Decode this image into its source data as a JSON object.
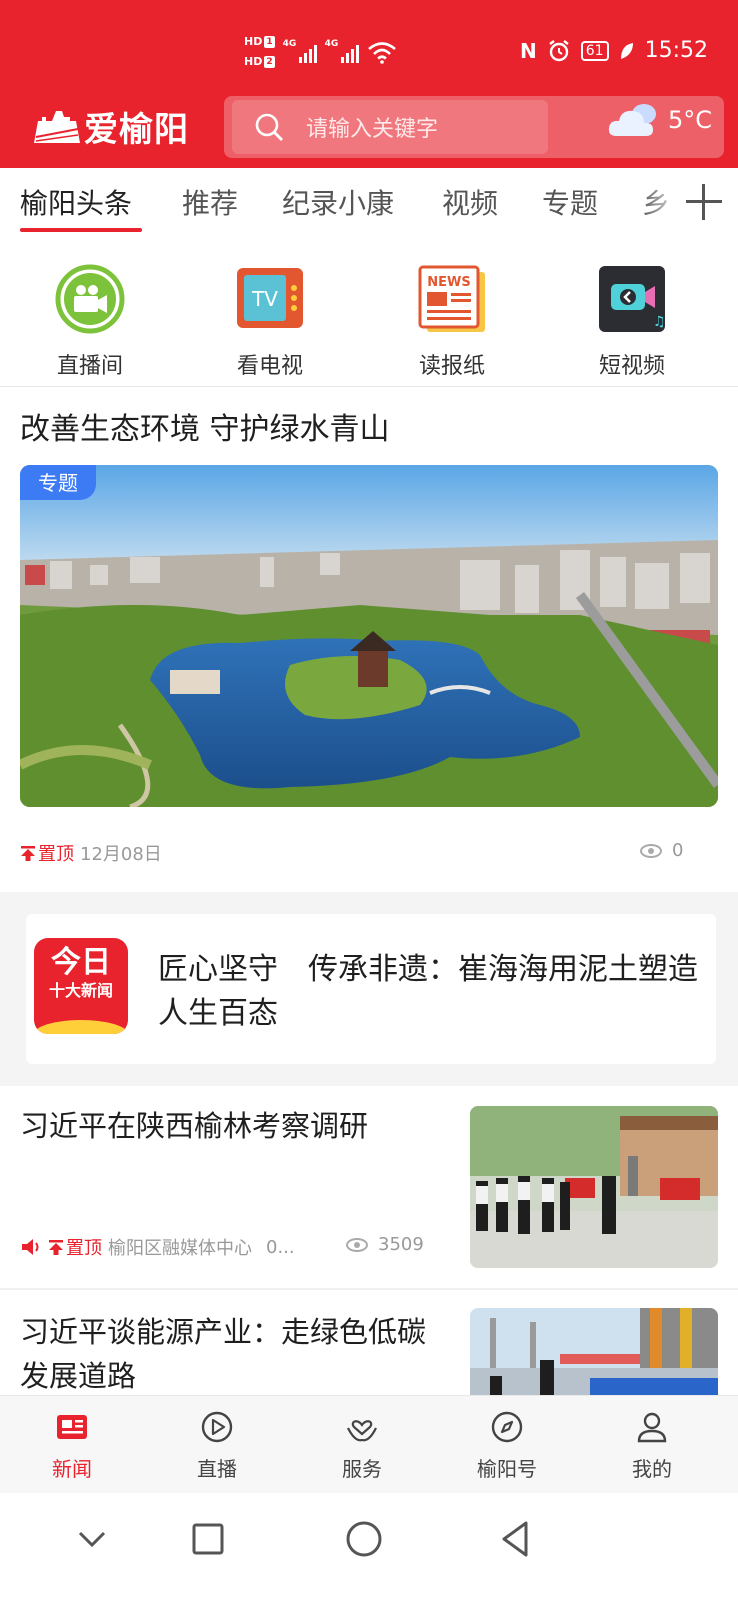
{
  "status_bar": {
    "hd1": "HD",
    "hd1_num": "1",
    "hd2": "HD",
    "hd2_num": "2",
    "net1": "4G",
    "net2": "4G",
    "nfc": "N",
    "battery": "61",
    "time": "15:52"
  },
  "header": {
    "app_name": "爱榆阳",
    "search_placeholder": "请输入关键字",
    "temperature": "5°C",
    "weather_icon": "cloudy-icon"
  },
  "tabs": [
    "榆阳头条",
    "推荐",
    "纪录小康",
    "视频",
    "专题",
    "乡"
  ],
  "active_tab": 0,
  "quick_links": [
    {
      "label": "直播间",
      "icon": "video-camera-icon"
    },
    {
      "label": "看电视",
      "icon": "tv-icon"
    },
    {
      "label": "读报纸",
      "icon": "newspaper-icon"
    },
    {
      "label": "短视频",
      "icon": "short-video-icon"
    }
  ],
  "feature": {
    "title": "改善生态环境 守护绿水青山",
    "tag": "专题",
    "pin": "置顶",
    "date": "12月08日",
    "views": "0"
  },
  "today_card": {
    "badge_line1": "今日",
    "badge_line2": "十大新闻",
    "title": "匠心坚守　传承非遗：崔海海用泥土塑造人生百态"
  },
  "news": [
    {
      "title": "习近平在陕西榆林考察调研",
      "pin": "置顶",
      "source": "榆阳区融媒体中心",
      "extra": "0...",
      "views": "3509"
    },
    {
      "title": "习近平谈能源产业：走绿色低碳发展道路"
    }
  ],
  "bottom_nav": [
    {
      "label": "新闻",
      "icon": "news-icon"
    },
    {
      "label": "直播",
      "icon": "play-icon"
    },
    {
      "label": "服务",
      "icon": "service-icon"
    },
    {
      "label": "榆阳号",
      "icon": "compass-icon"
    },
    {
      "label": "我的",
      "icon": "user-icon"
    }
  ],
  "colors": {
    "brand_red": "#e8232d",
    "tag_blue": "#3d7bf5"
  }
}
